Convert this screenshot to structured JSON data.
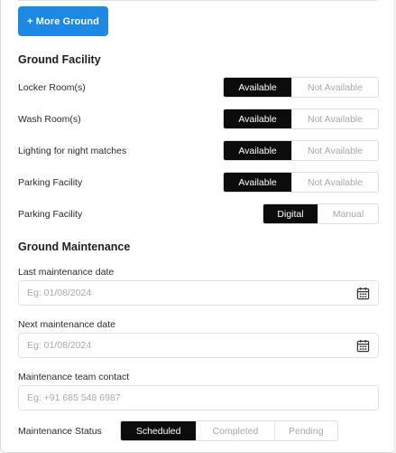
{
  "actions": {
    "more_ground_label": "+ More Ground"
  },
  "facility": {
    "title": "Ground Facility",
    "rows": [
      {
        "label": "Locker Room(s)",
        "options": [
          "Available",
          "Not Available"
        ],
        "selected": "Available"
      },
      {
        "label": "Wash Room(s)",
        "options": [
          "Available",
          "Not Available"
        ],
        "selected": "Available"
      },
      {
        "label": "Lighting for night matches",
        "options": [
          "Available",
          "Not Available"
        ],
        "selected": "Available"
      },
      {
        "label": "Parking Facility",
        "options": [
          "Available",
          "Not Available"
        ],
        "selected": "Available"
      },
      {
        "label": "Parking Facility",
        "options": [
          "Digital",
          "Manual"
        ],
        "selected": "Digital"
      }
    ]
  },
  "maintenance": {
    "title": "Ground Maintenance",
    "last_date": {
      "label": "Last maintenance date",
      "placeholder": "Eg: 01/08/2024",
      "value": ""
    },
    "next_date": {
      "label": "Next maintenance date",
      "placeholder": "Eg: 01/08/2024",
      "value": ""
    },
    "contact": {
      "label": "Maintenance team contact",
      "placeholder": "Eg: +91 685 548 6987",
      "value": ""
    },
    "status": {
      "label": "Maintenance Status",
      "options": [
        "Scheduled",
        "Completed",
        "Pending"
      ],
      "selected": "Scheduled"
    }
  },
  "icons": {
    "calendar": "calendar-icon"
  },
  "colors": {
    "primary": "#1e88e5",
    "toggle_active": "#0c0c0c",
    "toggle_inactive_text": "#a8a8a8",
    "border": "#dedede"
  }
}
